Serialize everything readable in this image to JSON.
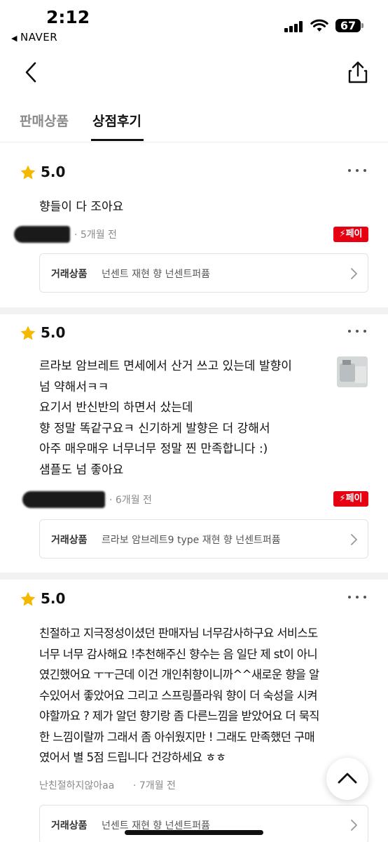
{
  "status_bar": {
    "time": "2:12",
    "back_app": "NAVER",
    "battery": "67"
  },
  "tabs": [
    {
      "label": "판매상품",
      "active": false
    },
    {
      "label": "상점후기",
      "active": true
    }
  ],
  "reviews": [
    {
      "rating": "5.0",
      "text": "향들이 다 조아요",
      "reviewer": "",
      "date": "· 5개월 전",
      "badge": "⚡페이",
      "product_label": "거래상품",
      "product_name": "넌센트 재현 향 넌센트퍼퓸",
      "has_photo": false
    },
    {
      "rating": "5.0",
      "text": "르라보 암브레트 면세에서 산거 쓰고 있는데 발향이\n넘 약해서ㅋㅋ\n요기서 반신반의 하면서 샀는데\n향 정말 똑같구요ㅋ 신기하게 발향은 더 강해서\n아주 매우매우 너무너무 정말 찐 만족합니다 :)\n샘플도 넘 좋아요",
      "reviewer": "",
      "date": "· 6개월 전",
      "badge": "⚡페이",
      "product_label": "거래상품",
      "product_name": "르라보 암브레트9 type 재현 향 넌센트퍼퓸",
      "has_photo": true
    },
    {
      "rating": "5.0",
      "text": "친절하고 지극정성이셨던 판매자님 너무감사하구요 서비스도\n너무 너무 감사해요 !추천해주신 향수는 음 일단 제 st이 아니\n였긴했어요 ㅜㅜ근데 이건 개인취향이니까^^새로운 향을 알\n수있어서 좋았어요 그리고 스프링플라워 향이 더 숙성을 시켜\n야할까요 ? 제가 알던 향기랑 좀 다른느낌을 받았어요 더 묵직\n한 느낌이랄까 그래서 좀 아쉬웠지만 ! 그래도 만족했던 구매\n였어서 별 5점 드립니다 건강하세요 ㅎㅎ",
      "reviewer": "난친절하지않아aa",
      "date": "· 7개월 전",
      "badge": "",
      "product_label": "거래상품",
      "product_name": "넌센트 재현 향 넌센트퍼퓸",
      "has_photo": false
    }
  ],
  "colors": {
    "accent_pay": "#e60012",
    "star": "#f5b800",
    "text": "#111111",
    "muted": "#8a8a8a"
  },
  "icons": [
    "back-arrow-icon",
    "share-icon",
    "star-icon",
    "more-icon",
    "chevron-right-icon",
    "chevron-up-icon",
    "signal-icon",
    "wifi-icon",
    "battery-icon"
  ]
}
